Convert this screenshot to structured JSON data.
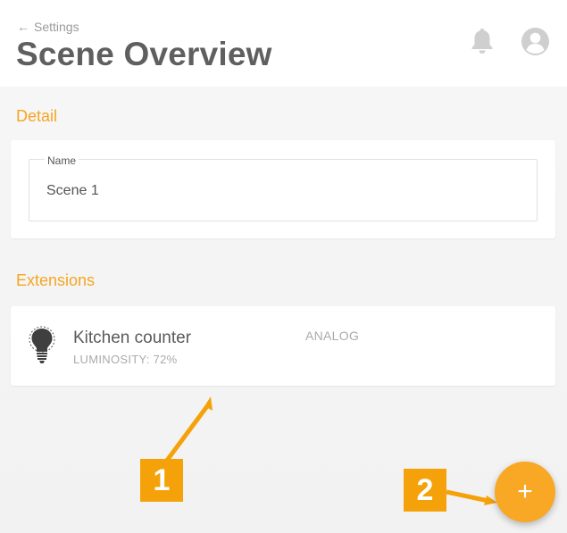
{
  "header": {
    "back_label": "Settings",
    "title": "Scene Overview",
    "icons": [
      "bell-icon",
      "account-icon"
    ]
  },
  "detail": {
    "section_title": "Detail",
    "name_field": {
      "label": "Name",
      "value": "Scene 1"
    }
  },
  "extensions": {
    "section_title": "Extensions",
    "items": [
      {
        "icon": "lightbulb-icon",
        "name": "Kitchen counter",
        "detail": "LUMINOSITY: 72%",
        "type": "ANALOG"
      }
    ]
  },
  "annotations": {
    "marker_1": "1",
    "marker_2": "2"
  },
  "fab": {
    "label": "+"
  },
  "colors": {
    "accent": "#f5a623",
    "marker": "#f5a20a",
    "title": "#5f5f5f",
    "background": "#f4f4f4"
  }
}
